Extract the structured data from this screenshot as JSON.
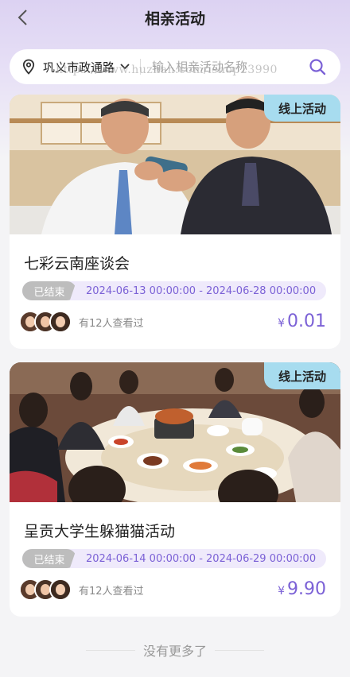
{
  "page": {
    "title": "相亲活动"
  },
  "search": {
    "location": "巩义市政通路",
    "placeholder": "输入相亲活动名称"
  },
  "watermark": "https://www.huzhan.com/ishop23990",
  "activities": [
    {
      "badge": "线上活动",
      "title": "七彩云南座谈会",
      "status": "已结束",
      "time_range": "2024-06-13 00:00:00 - 2024-06-28 00:00:00",
      "viewers_text": "有12人查看过",
      "currency": "¥",
      "price": "0.01"
    },
    {
      "badge": "线上活动",
      "title": "呈贡大学生躲猫猫活动",
      "status": "已结束",
      "time_range": "2024-06-14 00:00:00 - 2024-06-29 00:00:00",
      "viewers_text": "有12人查看过",
      "currency": "¥",
      "price": "9.90"
    }
  ],
  "footer": {
    "text": "没有更多了"
  },
  "colors": {
    "accent": "#7b61d6",
    "badge_bg": "#a7dcef",
    "status_bg": "#bdbdbd",
    "time_bg": "#efeafb"
  }
}
